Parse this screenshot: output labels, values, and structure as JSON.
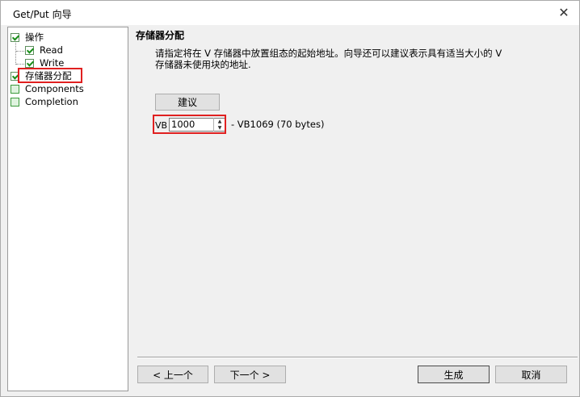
{
  "window": {
    "title": "Get/Put 向导",
    "close_symbol": "✕"
  },
  "tree": {
    "items": [
      {
        "label": "操作",
        "checked": true,
        "level": 0
      },
      {
        "label": "Read",
        "checked": true,
        "level": 1
      },
      {
        "label": "Write",
        "checked": true,
        "level": 1
      },
      {
        "label": "存储器分配",
        "checked": true,
        "level": 0,
        "selected": true
      },
      {
        "label": "Components",
        "checked": false,
        "level": 0
      },
      {
        "label": "Completion",
        "checked": false,
        "level": 0
      }
    ]
  },
  "page": {
    "title": "存储器分配",
    "description_line1": "请指定将在 V 存储器中放置组态的起始地址。向导还可以建议表示具有适当大小的 V",
    "description_line2": "存储器未使用块的地址."
  },
  "suggest_button": {
    "label": "建议"
  },
  "address": {
    "prefix": "VB",
    "value": "1000",
    "range_text": "- VB1069 (70 bytes)"
  },
  "footer": {
    "prev_label": "< 上一个",
    "next_label": "下一个 >",
    "generate_label": "生成",
    "cancel_label": "取消"
  },
  "colors": {
    "highlight": "#e02020",
    "check": "#1a8f1a"
  }
}
